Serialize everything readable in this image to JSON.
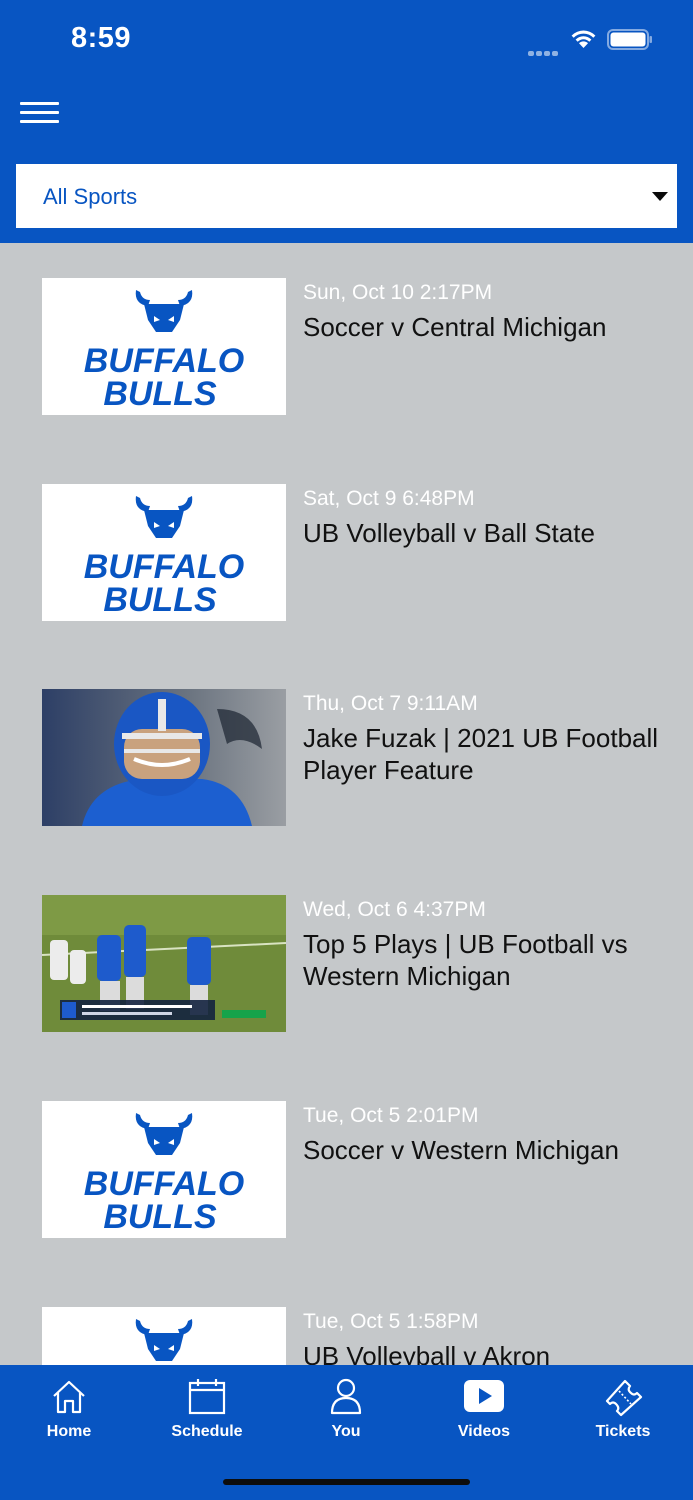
{
  "status_bar": {
    "time": "8:59"
  },
  "filter": {
    "selected": "All Sports"
  },
  "videos": [
    {
      "date": "Sun, Oct 10 2:17PM",
      "title": "Soccer v Central Michigan",
      "thumbnail": "buffalo-bulls-logo"
    },
    {
      "date": "Sat, Oct 9 6:48PM",
      "title": "UB Volleyball v Ball State",
      "thumbnail": "buffalo-bulls-logo"
    },
    {
      "date": "Thu, Oct 7 9:11AM",
      "title": "Jake Fuzak | 2021 UB Football Player Feature",
      "thumbnail": "football-player-photo"
    },
    {
      "date": "Wed, Oct 6 4:37PM",
      "title": "Top 5 Plays | UB Football vs Western Michigan",
      "thumbnail": "football-game-photo"
    },
    {
      "date": "Tue, Oct 5 2:01PM",
      "title": "Soccer v Western Michigan",
      "thumbnail": "buffalo-bulls-logo"
    },
    {
      "date": "Tue, Oct 5 1:58PM",
      "title": "UB Volleyball v Akron",
      "thumbnail": "buffalo-bulls-logo"
    }
  ],
  "logo": {
    "line1": "BUFFALO",
    "line2": "BULLS"
  },
  "tabs": [
    {
      "label": "Home",
      "icon": "house-icon"
    },
    {
      "label": "Schedule",
      "icon": "calendar-icon"
    },
    {
      "label": "You",
      "icon": "person-icon"
    },
    {
      "label": "Videos",
      "icon": "play-icon"
    },
    {
      "label": "Tickets",
      "icon": "ticket-icon"
    }
  ],
  "colors": {
    "brand_blue": "#0855c2",
    "list_background": "#c5c8ca"
  }
}
